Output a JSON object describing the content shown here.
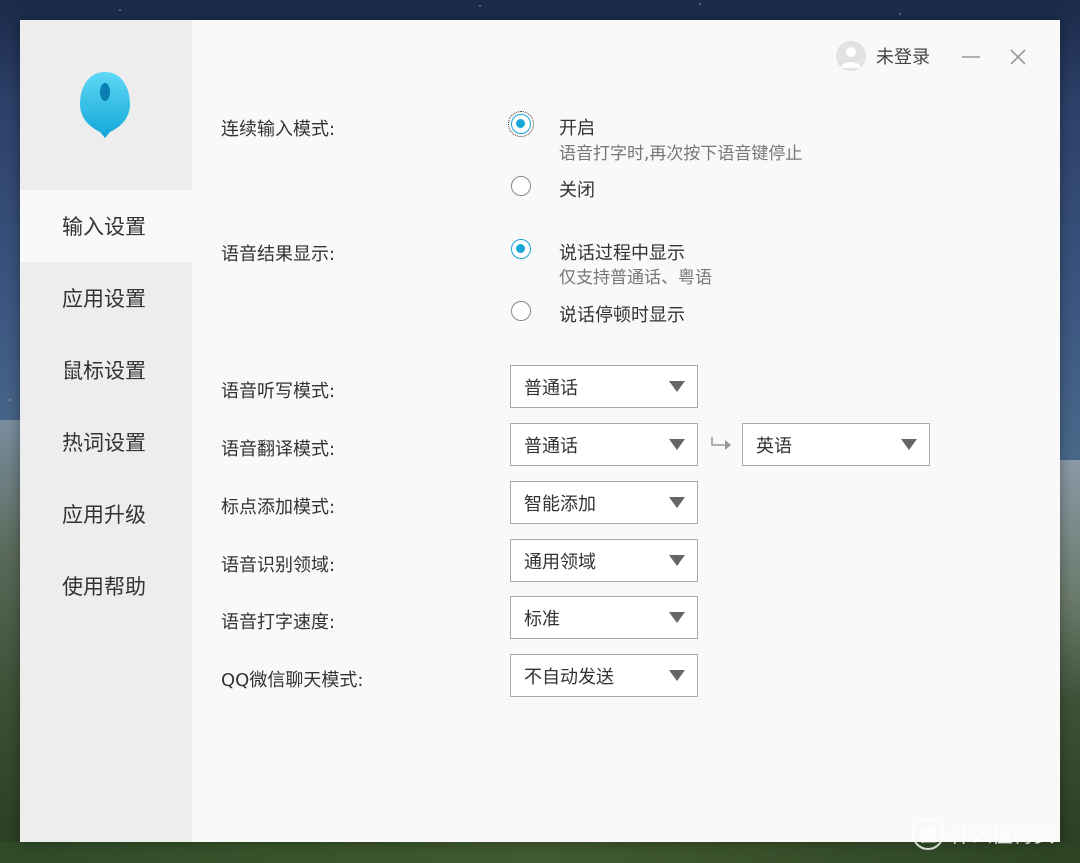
{
  "watermark": {
    "logo_char": "值",
    "text": "什么值得买"
  },
  "topbar": {
    "login_status": "未登录"
  },
  "sidebar": {
    "items": [
      {
        "label": "输入设置",
        "active": true
      },
      {
        "label": "应用设置"
      },
      {
        "label": "鼠标设置"
      },
      {
        "label": "热词设置"
      },
      {
        "label": "应用升级"
      },
      {
        "label": "使用帮助"
      }
    ]
  },
  "continuous_mode": {
    "label": "连续输入模式:",
    "on_label": "开启",
    "on_hint": "语音打字时,再次按下语音键停止",
    "off_label": "关闭",
    "selected": "on"
  },
  "result_display": {
    "label": "语音结果显示:",
    "during_label": "说话过程中显示",
    "during_hint": "仅支持普通话、粤语",
    "pause_label": "说话停顿时显示",
    "selected": "during"
  },
  "dictation_mode": {
    "label": "语音听写模式:",
    "value": "普通话"
  },
  "translation_mode": {
    "label": "语音翻译模式:",
    "from": "普通话",
    "to": "英语"
  },
  "punctuation_mode": {
    "label": "标点添加模式:",
    "value": "智能添加"
  },
  "recognition_domain": {
    "label": "语音识别领域:",
    "value": "通用领域"
  },
  "typing_speed": {
    "label": "语音打字速度:",
    "value": "标准"
  },
  "qq_wechat_mode": {
    "label": "QQ微信聊天模式:",
    "value": "不自动发送"
  },
  "colors": {
    "accent": "#1aa6d6",
    "sidebar_bg": "#ededed",
    "content_bg": "#f9f9f9"
  }
}
